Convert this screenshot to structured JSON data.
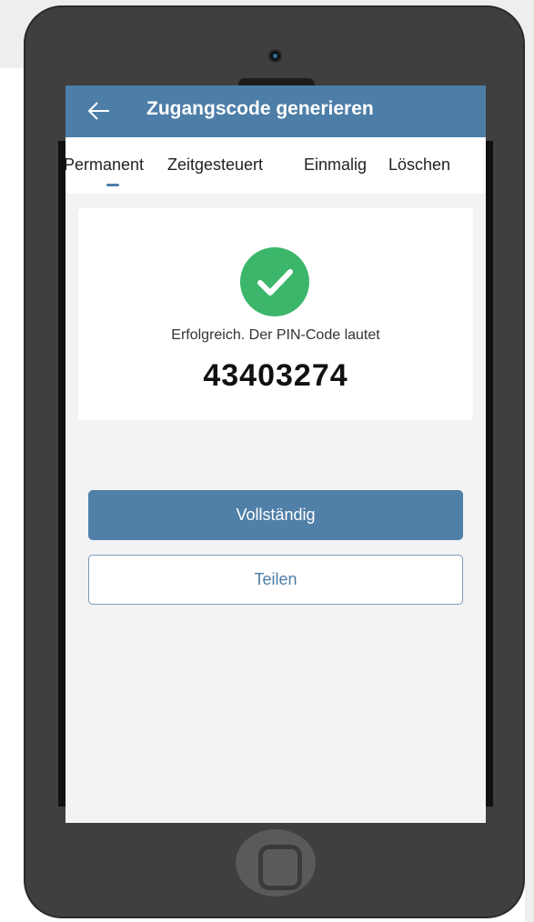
{
  "header": {
    "title": "Zugangscode generieren",
    "back_icon": "arrow-left-icon"
  },
  "tabs": [
    {
      "label": "Permanent",
      "active": true
    },
    {
      "label": "Zeitgesteuert",
      "active": false
    },
    {
      "label": "Einmalig",
      "active": false
    },
    {
      "label": "Löschen",
      "active": false
    }
  ],
  "result": {
    "status_icon": "check-circle-icon",
    "message": "Erfolgreich. Der PIN-Code lautet",
    "pin": "43403274"
  },
  "actions": {
    "complete_label": "Vollständig",
    "share_label": "Teilen"
  },
  "colors": {
    "accent": "#4d7ea8",
    "success": "#3cb66b",
    "device": "#3f3f3f"
  }
}
